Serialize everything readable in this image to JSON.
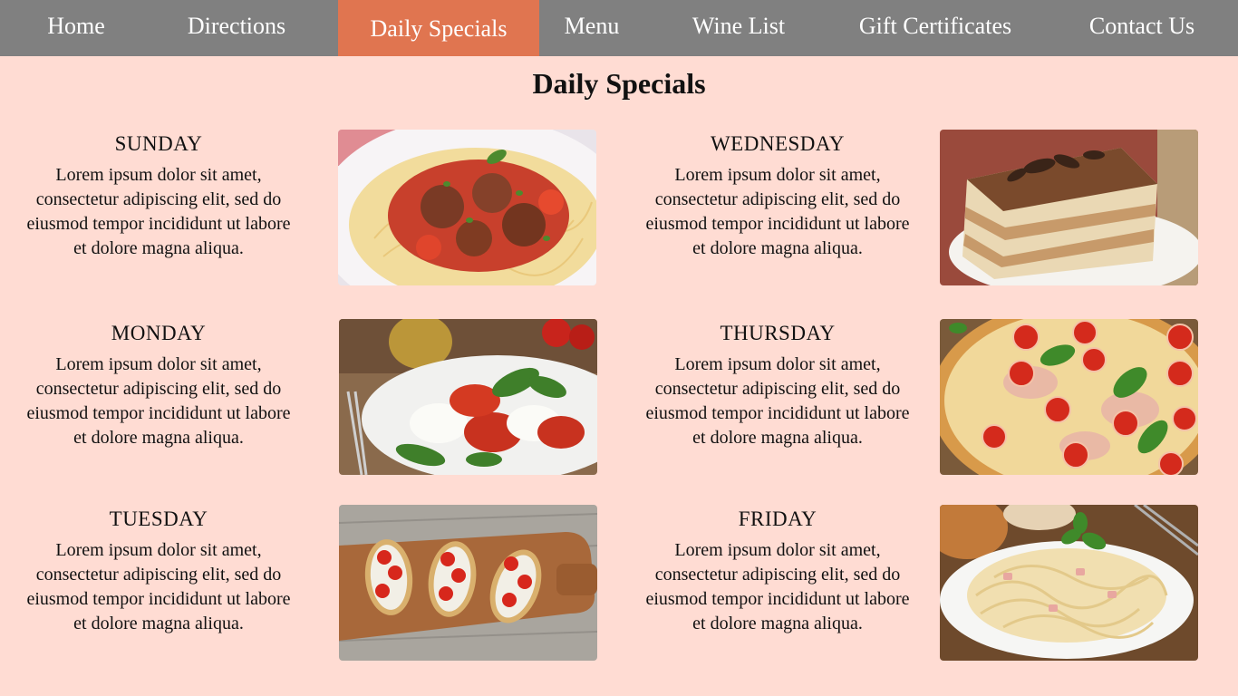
{
  "nav": {
    "items": [
      {
        "label": "Home"
      },
      {
        "label": "Directions"
      },
      {
        "label": "Daily Specials"
      },
      {
        "label": "Menu"
      },
      {
        "label": "Wine List"
      },
      {
        "label": "Gift Certificates"
      },
      {
        "label": "Contact Us"
      }
    ],
    "active": "Daily Specials"
  },
  "page": {
    "title": "Daily Specials"
  },
  "specials": [
    {
      "day": "SUNDAY",
      "description": "Lorem ipsum dolor sit amet, consectetur adipiscing elit, sed do eiusmod tempor incididunt ut labore et dolore magna aliqua.",
      "image": "spaghetti-meatballs"
    },
    {
      "day": "MONDAY",
      "description": "Lorem ipsum dolor sit amet, consectetur adipiscing elit, sed do eiusmod tempor incididunt ut labore et dolore magna aliqua.",
      "image": "caprese-salad"
    },
    {
      "day": "TUESDAY",
      "description": "Lorem ipsum dolor sit amet, consectetur adipiscing elit, sed do eiusmod tempor incididunt ut labore et dolore magna aliqua.",
      "image": "bruschetta"
    },
    {
      "day": "WEDNESDAY",
      "description": "Lorem ipsum dolor sit amet, consectetur adipiscing elit, sed do eiusmod tempor incididunt ut labore et dolore magna aliqua.",
      "image": "tiramisu"
    },
    {
      "day": "THURSDAY",
      "description": "Lorem ipsum dolor sit amet, consectetur adipiscing elit, sed do eiusmod tempor incididunt ut labore et dolore magna aliqua.",
      "image": "pizza"
    },
    {
      "day": "FRIDAY",
      "description": "Lorem ipsum dolor sit amet, consectetur adipiscing elit, sed do eiusmod tempor incididunt ut labore et dolore magna aliqua.",
      "image": "fettuccine-alfredo"
    }
  ],
  "colors": {
    "background": "#ffdcd3",
    "nav": "#808080",
    "nav_active": "#e07550",
    "nav_text": "#ffffff"
  }
}
